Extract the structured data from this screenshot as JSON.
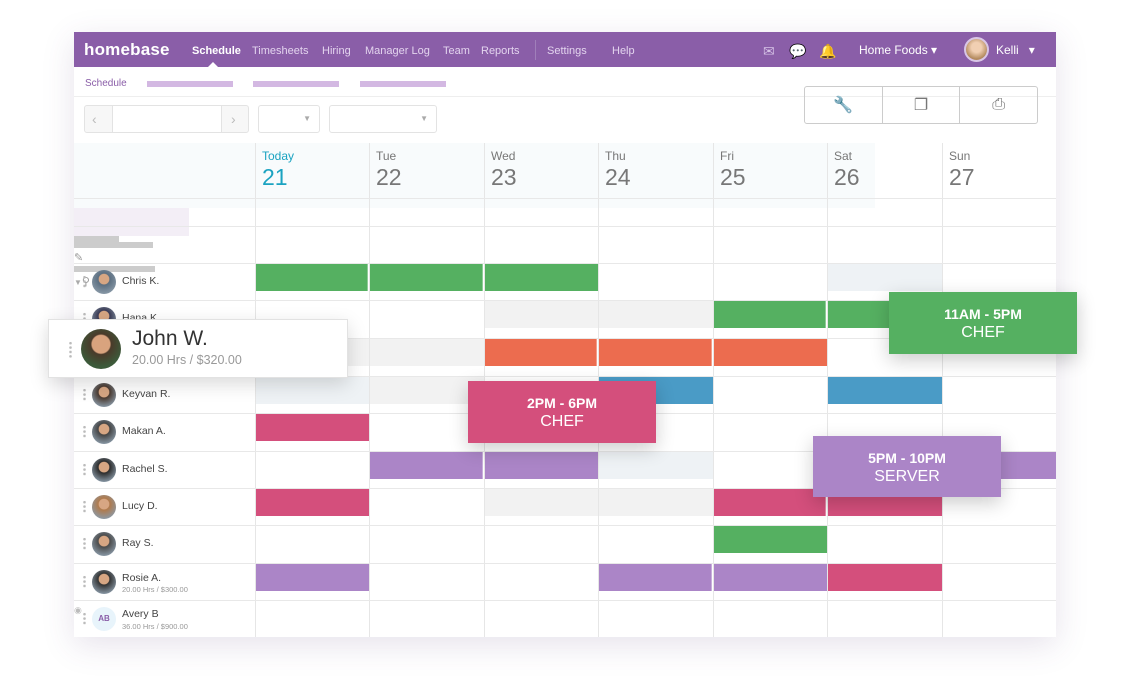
{
  "nav": {
    "logo": "homebase",
    "items": [
      "Schedule",
      "Timesheets",
      "Hiring",
      "Manager Log",
      "Team",
      "Reports",
      "Settings",
      "Help"
    ],
    "active": "Schedule",
    "location": "Home Foods",
    "user": "Kelli",
    "icons": [
      "mail-icon",
      "chat-icon",
      "bell-icon"
    ]
  },
  "subnav": {
    "label": "Schedule"
  },
  "toolbar": {
    "icons": [
      "wrench-icon",
      "copy-icon",
      "print-icon"
    ]
  },
  "days": [
    {
      "d": "Today",
      "n": "21"
    },
    {
      "d": "Tue",
      "n": "22"
    },
    {
      "d": "Wed",
      "n": "23"
    },
    {
      "d": "Thu",
      "n": "24"
    },
    {
      "d": "Fri",
      "n": "25"
    },
    {
      "d": "Sat",
      "n": "26"
    },
    {
      "d": "Sun",
      "n": "27"
    }
  ],
  "employees": [
    {
      "name": "Chris K.",
      "sub": ""
    },
    {
      "name": "Hana K.",
      "sub": ""
    },
    {
      "name": "John W.",
      "sub": ""
    },
    {
      "name": "Keyvan R.",
      "sub": ""
    },
    {
      "name": "Makan A.",
      "sub": ""
    },
    {
      "name": "Rachel S.",
      "sub": ""
    },
    {
      "name": "Lucy D.",
      "sub": ""
    },
    {
      "name": "Ray S.",
      "sub": ""
    },
    {
      "name": "Rosie A.",
      "sub": "20.00 Hrs / $300.00"
    },
    {
      "name": "Avery B",
      "sub": "36.00 Hrs / $900.00",
      "initials": "AB"
    }
  ],
  "drag_card": {
    "name": "John W.",
    "sub": "20.00 Hrs / $320.00"
  },
  "popups": [
    {
      "time": "11AM - 5PM",
      "role": "CHEF",
      "color": "#55b061"
    },
    {
      "time": "2PM - 6PM",
      "role": "CHEF",
      "color": "#d44f7c"
    },
    {
      "time": "5PM - 10PM",
      "role": "SERVER",
      "color": "#ab85c7"
    }
  ],
  "colors": {
    "brand": "#8a5ea8",
    "today": "#1ba3c1",
    "green": "#55b061",
    "orange": "#ec6c4f",
    "blue": "#4a9bc6",
    "pink": "#d44f7c",
    "purple": "#ab85c7"
  }
}
